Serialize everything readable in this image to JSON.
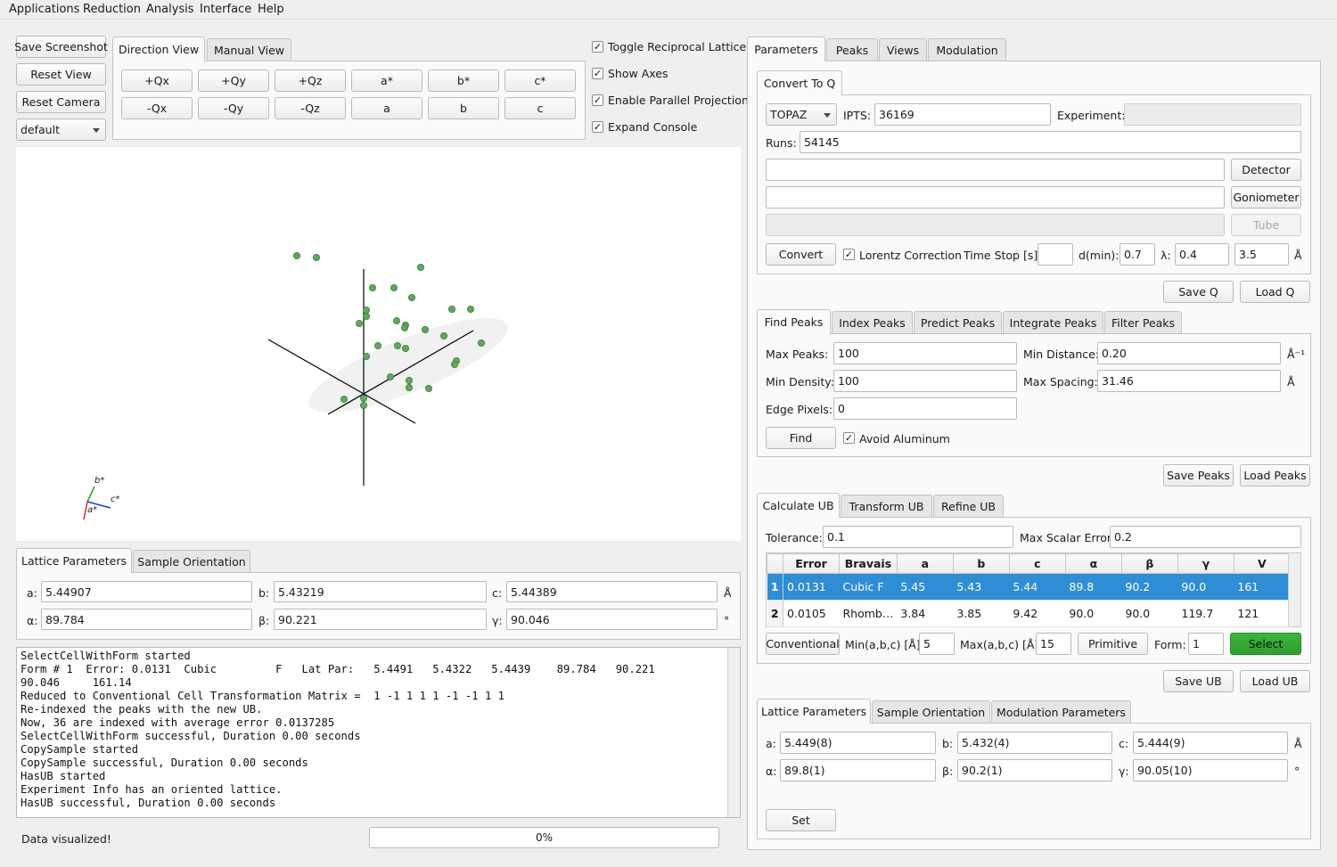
{
  "menu": [
    "Applications",
    "Reduction",
    "Analysis",
    "Interface",
    "Help"
  ],
  "left": {
    "save_screenshot": "Save Screenshot",
    "reset_view": "Reset View",
    "reset_camera": "Reset Camera",
    "colormap": "default",
    "view_tabs": [
      "Direction View",
      "Manual View"
    ],
    "dir_buttons_row1": [
      "+Qx",
      "+Qy",
      "+Qz",
      "a*",
      "b*",
      "c*"
    ],
    "dir_buttons_row2": [
      "-Qx",
      "-Qy",
      "-Qz",
      "a",
      "b",
      "c"
    ],
    "checks": [
      {
        "label": "Toggle Reciprocal Lattice",
        "checked": true
      },
      {
        "label": "Show Axes",
        "checked": true
      },
      {
        "label": "Enable Parallel Projection",
        "checked": true
      },
      {
        "label": "Expand Console",
        "checked": true
      }
    ],
    "axes_labels": {
      "b": "b*",
      "c": "c*",
      "a": "a*"
    },
    "lattice_tabs": [
      "Lattice Parameters",
      "Sample Orientation"
    ],
    "lattice": {
      "a_label": "a:",
      "a": "5.44907",
      "b_label": "b:",
      "b": "5.43219",
      "c_label": "c:",
      "c": "5.44389",
      "len_unit": "Å",
      "alpha_label": "α:",
      "alpha": "89.784",
      "beta_label": "β:",
      "beta": "90.221",
      "gamma_label": "γ:",
      "gamma": "90.046",
      "ang_unit": "°"
    },
    "console": "SelectCellWithForm started\nForm # 1  Error: 0.0131  Cubic         F   Lat Par:   5.4491   5.4322   5.4439    89.784   90.221\n90.046     161.14\nReduced to Conventional Cell Transformation Matrix =  1 -1 1 1 1 -1 -1 1 1\nRe-indexed the peaks with the new UB.\nNow, 36 are indexed with average error 0.0137285\nSelectCellWithForm successful, Duration 0.00 seconds\nCopySample started\nCopySample successful, Duration 0.00 seconds\nHasUB started\nExperiment Info has an oriented lattice.\nHasUB successful, Duration 0.00 seconds",
    "status": "Data visualized!",
    "progress": "0%"
  },
  "right": {
    "main_tabs": [
      "Parameters",
      "Peaks",
      "Views",
      "Modulation"
    ],
    "convert_tab": "Convert To Q",
    "instrument": "TOPAZ",
    "ipts_label": "IPTS:",
    "ipts": "36169",
    "experiment_label": "Experiment:",
    "experiment": "",
    "runs_label": "Runs:",
    "runs": "54145",
    "detector_btn": "Detector",
    "goniometer_btn": "Goniometer",
    "tube_btn": "Tube",
    "convert_btn": "Convert",
    "lorentz_label": "Lorentz Correction",
    "time_stop_label": "Time Stop [s]:",
    "time_stop": "",
    "dmin_label": "d(min):",
    "dmin": "0.7",
    "lambda_label": "λ:",
    "lambda_min": "0.4",
    "lambda_max": "3.5",
    "ang_unit": "Å",
    "save_q": "Save Q",
    "load_q": "Load Q",
    "peak_tabs": [
      "Find Peaks",
      "Index Peaks",
      "Predict Peaks",
      "Integrate Peaks",
      "Filter Peaks"
    ],
    "max_peaks_label": "Max Peaks:",
    "max_peaks": "100",
    "min_distance_label": "Min Distance:",
    "min_distance": "0.20",
    "inv_ang": "Å⁻¹",
    "min_density_label": "Min Density:",
    "min_density": "100",
    "max_spacing_label": "Max Spacing:",
    "max_spacing": "31.46",
    "edge_pixels_label": "Edge Pixels:",
    "edge_pixels": "0",
    "find_btn": "Find",
    "avoid_al": "Avoid Aluminum",
    "save_peaks": "Save Peaks",
    "load_peaks": "Load Peaks",
    "ub_tabs": [
      "Calculate UB",
      "Transform UB",
      "Refine UB"
    ],
    "tolerance_label": "Tolerance:",
    "tolerance": "0.1",
    "max_scalar_label": "Max Scalar Error:",
    "max_scalar": "0.2",
    "table_headers": [
      "Error",
      "Bravais",
      "a",
      "b",
      "c",
      "α",
      "β",
      "γ",
      "V"
    ],
    "table_rows": [
      [
        "1",
        "0.0131",
        "Cubic F",
        "5.45",
        "5.43",
        "5.44",
        "89.8",
        "90.2",
        "90.0",
        "161"
      ],
      [
        "2",
        "0.0105",
        "Rhomb…",
        "3.84",
        "3.85",
        "9.42",
        "90.0",
        "90.0",
        "119.7",
        "121"
      ]
    ],
    "conventional_btn": "Conventional",
    "min_abc_label": "Min(a,b,c) [Å]:",
    "min_abc": "5",
    "max_abc_label": "Max(a,b,c) [Å]:",
    "max_abc": "15",
    "primitive_btn": "Primitive",
    "form_label": "Form:",
    "form": "1",
    "select_btn": "Select",
    "save_ub": "Save UB",
    "load_ub": "Load UB",
    "lattice_tabs": [
      "Lattice Parameters",
      "Sample Orientation",
      "Modulation Parameters"
    ],
    "lat": {
      "a_label": "a:",
      "a": "5.449(8)",
      "b_label": "b:",
      "b": "5.432(4)",
      "c_label": "c:",
      "c": "5.444(9)",
      "len_unit": "Å",
      "alpha_label": "α:",
      "alpha": "89.8(1)",
      "beta_label": "β:",
      "beta": "90.2(1)",
      "gamma_label": "γ:",
      "gamma": "90.05(10)",
      "ang_unit": "°"
    },
    "set_btn": "Set"
  }
}
